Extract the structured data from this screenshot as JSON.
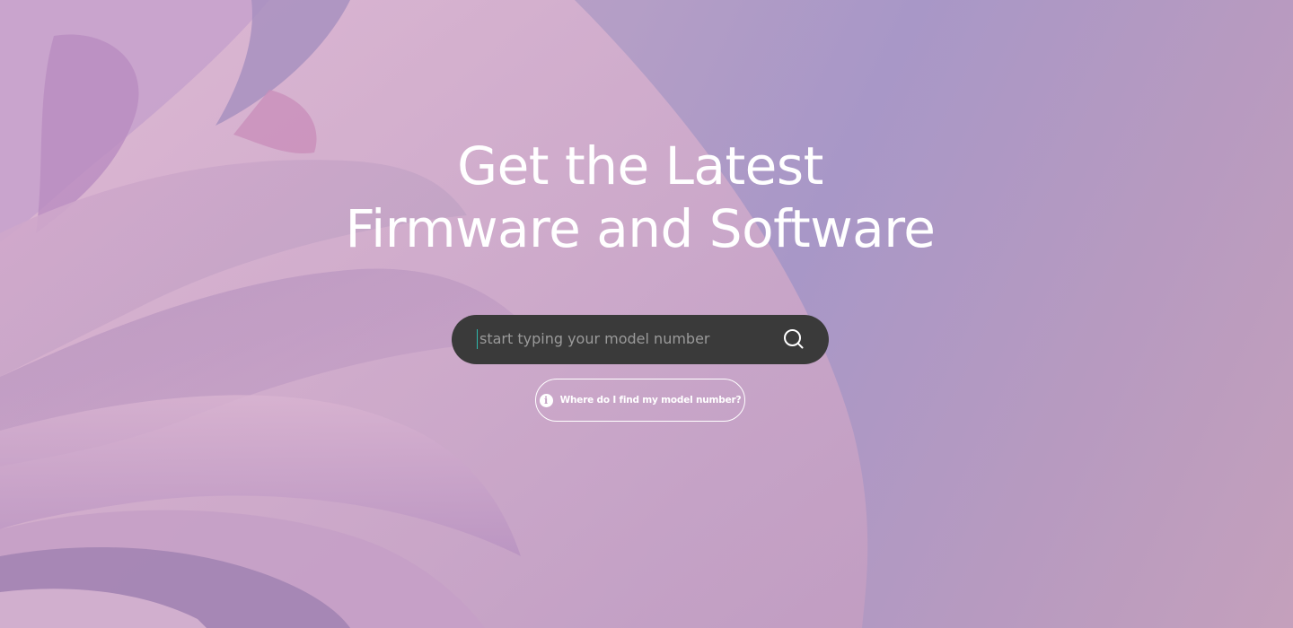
{
  "hero": {
    "headline_line1": "Get the Latest",
    "headline_line2": "Firmware and Software"
  },
  "search": {
    "placeholder": "start typing your model number",
    "value": "",
    "button_icon": "search-icon"
  },
  "help_link": {
    "icon": "info-icon",
    "icon_glyph": "i",
    "label": "Where do I find my model number?"
  },
  "colors": {
    "search_bg": "#3a3a3a",
    "caret": "#2fb8ac",
    "text": "#ffffff"
  }
}
